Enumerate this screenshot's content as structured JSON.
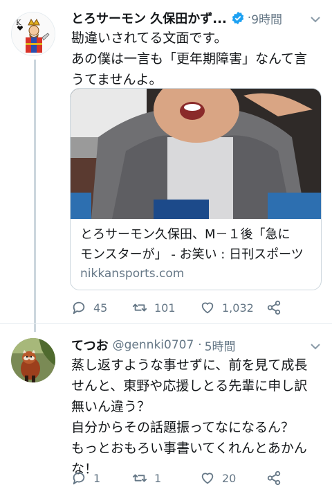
{
  "tweets": [
    {
      "name": "とろサーモン 久保田かず...",
      "handle": "",
      "time": "9時間",
      "time_sep": "·",
      "lines": [
        "勘違いされてる文面です。",
        "あの僕は一言も「更年期障害」なんて言",
        "うてませんよ。"
      ],
      "card": {
        "title_lines": [
          "とろサーモン久保田、M－１後「急に",
          "モンスターが」 - お笑い : 日刊スポーツ"
        ],
        "domain": "nikkansports.com"
      },
      "actions": {
        "replies": "45",
        "retweets": "101",
        "likes": "1,032"
      }
    },
    {
      "name": "てつお",
      "handle": "@gennki0707",
      "time": "5時間",
      "time_sep": "·",
      "lines": [
        "蒸し返すような事せずに、前を見て成長",
        "せんと、東野や応援しとる先輩に申し訳",
        "無いん違う？",
        "自分からその話題振ってなになるん？",
        "もっとおもろい事書いてくれんとあかん",
        "な！"
      ],
      "actions": {
        "replies": "1",
        "retweets": "1",
        "likes": "20"
      }
    }
  ],
  "icons": {
    "reply": "reply-icon",
    "retweet": "retweet-icon",
    "like": "heart-icon",
    "share": "share-icon",
    "verified": "verified-badge-icon",
    "menu": "chevron-down-icon"
  },
  "colors": {
    "text": "#14171a",
    "secondary": "#657786",
    "verified": "#1da1f2",
    "border": "#ccd6dd"
  }
}
